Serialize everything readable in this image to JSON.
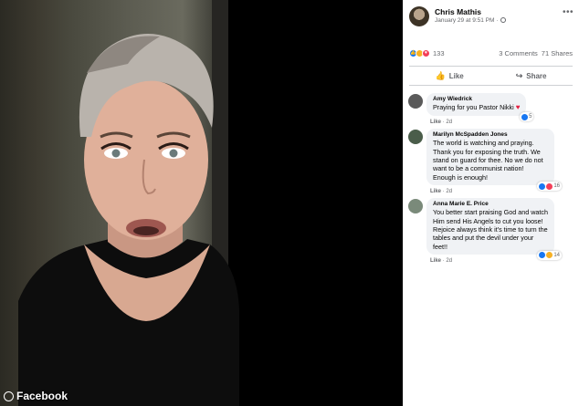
{
  "video": {
    "watermark": "Facebook"
  },
  "post": {
    "author": "Chris Mathis",
    "timestamp": "January 29 at 9:51 PM",
    "reaction_count": "133",
    "comments_count": "3 Comments",
    "shares_count": "71 Shares",
    "actions": {
      "like": "Like",
      "share": "Share"
    }
  },
  "comments": [
    {
      "name": "Amy Wiedrick",
      "text": "Praying for you Pastor Nikki",
      "reaction_count": "5",
      "like": "Like",
      "age": "2d",
      "avatar_color": "#5a5a5a"
    },
    {
      "name": "Marilyn McSpadden Jones",
      "text": "The world is watching and praying. Thank you for exposing the truth. We stand on guard for thee. No we do not want to be a communist nation! Enough is enough!",
      "reaction_count": "16",
      "like": "Like",
      "age": "2d",
      "avatar_color": "#4a5d4a"
    },
    {
      "name": "Anna Marie E. Price",
      "text": "You better start praising God and watch Him send His Angels to cut you loose! Rejoice always think it's time to turn the tables and put the devil under your feet!!",
      "reaction_count": "14",
      "like": "Like",
      "age": "2d",
      "avatar_color": "#7a8a7a"
    }
  ],
  "colors": {
    "like_blue": "#1877f2",
    "love_red": "#f33e58",
    "care_yellow": "#f7b125",
    "text_secondary": "#65676b"
  },
  "icons": [
    "like-reaction-icon",
    "care-reaction-icon",
    "love-reaction-icon",
    "thumbs-up-icon",
    "share-arrow-icon",
    "globe-icon",
    "more-options-icon",
    "heart-icon",
    "facebook-logo-icon"
  ]
}
